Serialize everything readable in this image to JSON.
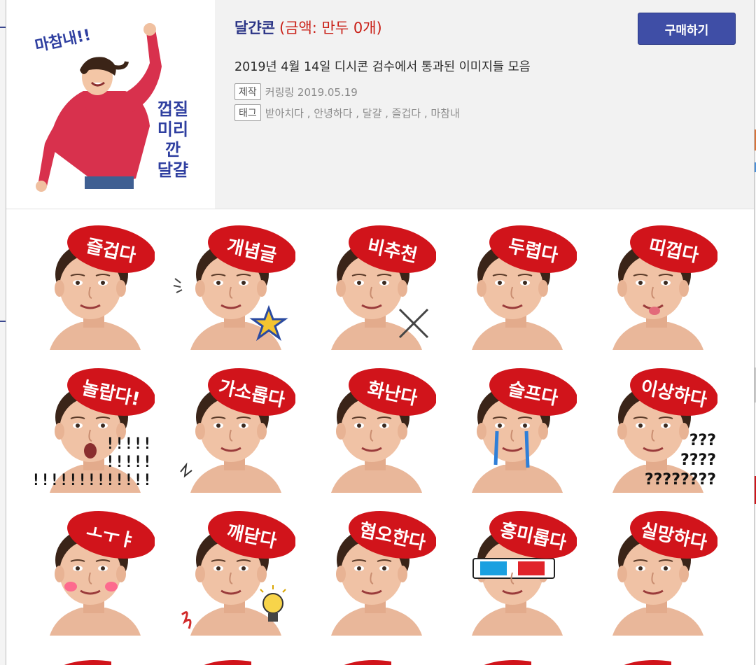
{
  "product": {
    "title": "달갼콘",
    "price_text": "(금액: 만두 0개)",
    "buy_label": "구매하기",
    "description": "2019년 4월 14일 디시콘 검수에서 통과된 이미지들 모음",
    "maker_label": "제작",
    "maker_value": "커링링 2019.05.19",
    "tags_label": "태그",
    "tags_value": "받아치다 , 안녕하다 , 달걀 , 즐겁다 , 마참내"
  },
  "thumbnail": {
    "text_top": "마참내!!",
    "text_lines": [
      "껍질",
      "미리",
      "깐",
      "달걀"
    ]
  },
  "emoticons": [
    {
      "label": "즐겁다",
      "accessory": "none"
    },
    {
      "label": "개념글",
      "accessory": "star"
    },
    {
      "label": "비추천",
      "accessory": "x-mark"
    },
    {
      "label": "두렵다",
      "accessory": "none"
    },
    {
      "label": "띠껍다",
      "accessory": "tongue"
    },
    {
      "label": "놀랍다!",
      "accessory": "exclaim"
    },
    {
      "label": "가소롭다",
      "accessory": "squiggle"
    },
    {
      "label": "화난다",
      "accessory": "none"
    },
    {
      "label": "슬프다",
      "accessory": "tears"
    },
    {
      "label": "이상하다",
      "accessory": "question"
    },
    {
      "label": "ㅗㅜㅑ",
      "accessory": "blush"
    },
    {
      "label": "깨닫다",
      "accessory": "bulb"
    },
    {
      "label": "혐오한다",
      "accessory": "none"
    },
    {
      "label": "흥미롭다",
      "accessory": "glasses-3d"
    },
    {
      "label": "실망하다",
      "accessory": "none"
    }
  ],
  "accessory_text": {
    "exclaim_lines": [
      "!!!!!",
      "!!!!!",
      "!!!!!!!!!!!!!!!"
    ],
    "question_lines": [
      "???",
      "????",
      "????????"
    ]
  },
  "colors": {
    "accent": "#3f4ea6",
    "title": "#2b3586",
    "price": "#c91f16",
    "cap_red": "#d1141b"
  }
}
